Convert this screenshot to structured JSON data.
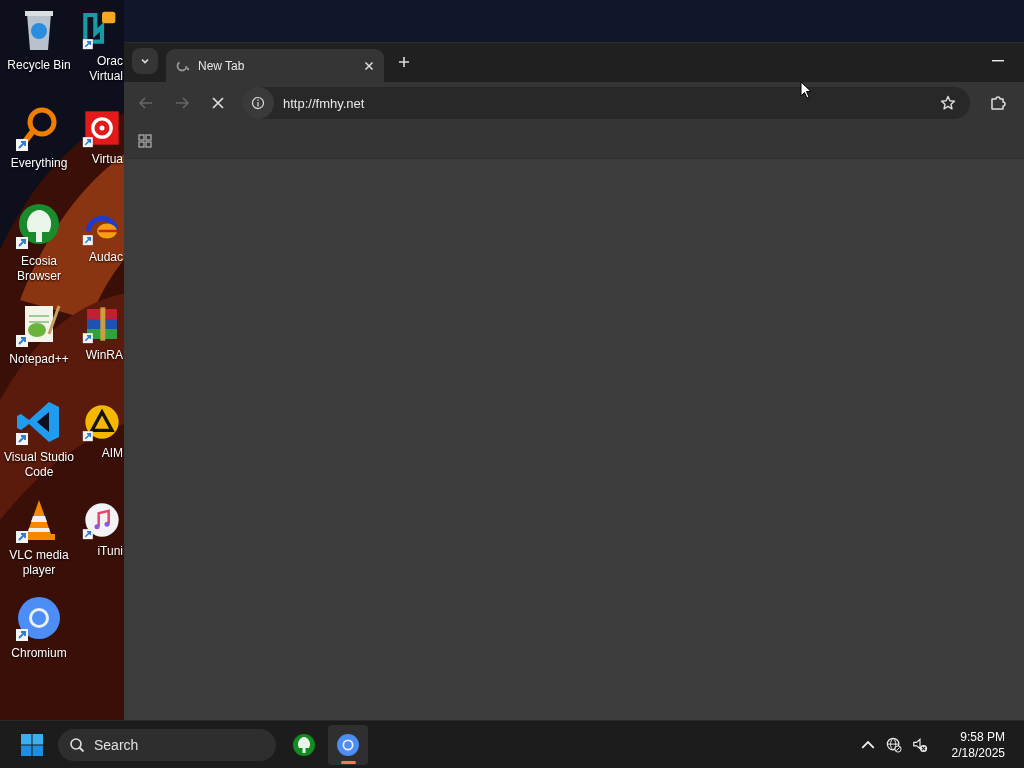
{
  "desktop": {
    "icons": [
      {
        "label": "Recycle Bin"
      },
      {
        "label": "Everything"
      },
      {
        "label": "Ecosia Browser"
      },
      {
        "label": "Notepad++"
      },
      {
        "label": "Visual Studio Code"
      },
      {
        "label": "VLC media player"
      },
      {
        "label": "Chromium"
      },
      {
        "label": "Orac\nVirtual"
      },
      {
        "label": "Virtua"
      },
      {
        "label": "Audac"
      },
      {
        "label": "WinRA"
      },
      {
        "label": "AIM"
      },
      {
        "label": "iTuni"
      }
    ]
  },
  "browser": {
    "tabs": [
      {
        "title": "New Tab",
        "selected": true,
        "loading": true
      }
    ],
    "toolbar": {
      "back_disabled": true,
      "forward_disabled": true,
      "loading": true
    },
    "address": {
      "value": "http://fmhy.net"
    }
  },
  "taskbar": {
    "search": {
      "placeholder": "Search"
    },
    "apps": [
      {
        "active": false
      },
      {
        "active": true
      }
    ],
    "clock": {
      "time": "9:58 PM",
      "date": "2/18/2025"
    }
  }
}
